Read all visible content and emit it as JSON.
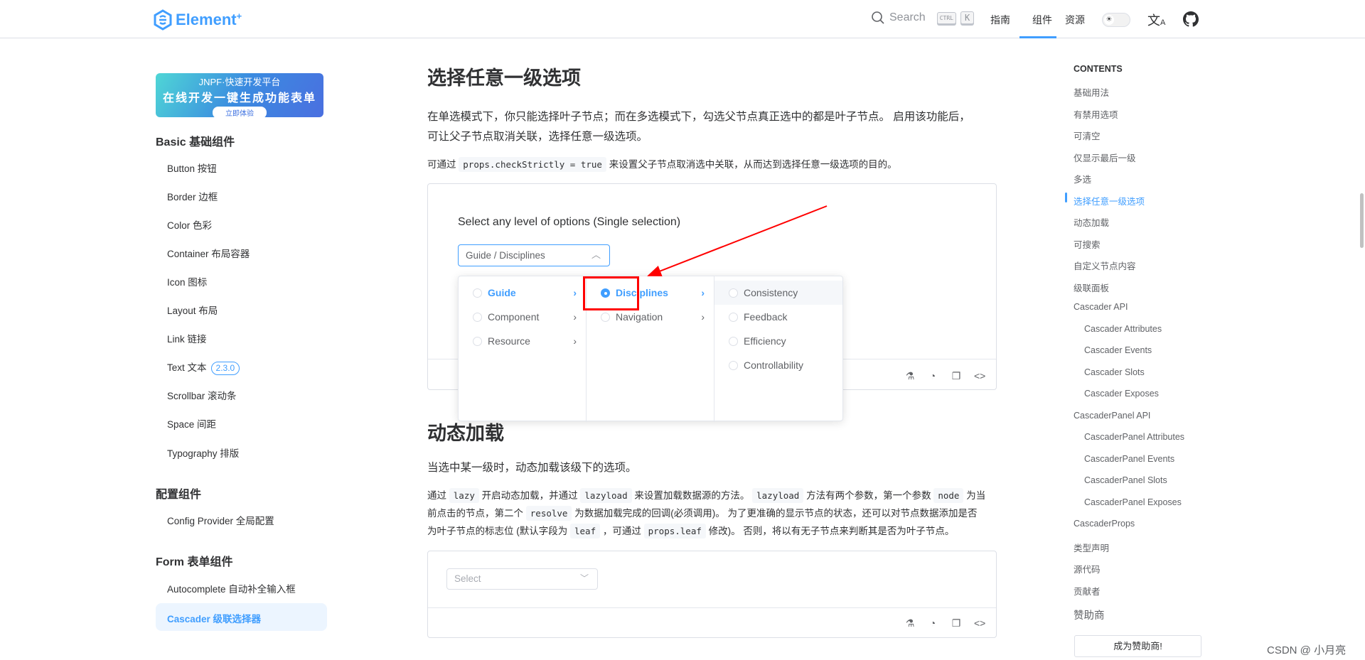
{
  "header": {
    "logo_text": "Element",
    "logo_sup": "+",
    "search": "Search",
    "kbd_ctrl": "CTRL",
    "kbd_k": "K",
    "nav": [
      "指南",
      "组件",
      "资源"
    ],
    "active_nav": "组件"
  },
  "banner": {
    "line1": "JNPF·快速开发平台",
    "line2": "在线开发一键生成功能表单",
    "button": "立即体验"
  },
  "sidebar": {
    "groups": [
      {
        "title": "Basic 基础组件",
        "items": [
          "Button 按钮",
          "Border 边框",
          "Color 色彩",
          "Container 布局容器",
          "Icon 图标",
          "Layout 布局",
          "Link 链接",
          "Text 文本",
          "Scrollbar 滚动条",
          "Space 间距",
          "Typography 排版"
        ]
      },
      {
        "title": "配置组件",
        "items": [
          "Config Provider 全局配置"
        ]
      },
      {
        "title": "Form 表单组件",
        "items": [
          "Autocomplete 自动补全输入框",
          "Cascader 级联选择器"
        ]
      }
    ],
    "text_badge": "2.3.0",
    "active": "Cascader 级联选择器"
  },
  "main": {
    "title1": "选择任意一级选项",
    "para1_line1": "在单选模式下，你只能选择叶子节点；而在多选模式下，勾选父节点真正选中的都是叶子节点。 启用该功能后，",
    "para1_line2": "可让父子节点取消关联，选择任意一级选项。",
    "para2_pre": "可通过 ",
    "para2_code": "props.checkStrictly = true",
    "para2_post": " 来设置父子节点取消选中关联，从而达到选择任意一级选项的目的。",
    "demo1": {
      "label": "Select any level of options (Single selection)",
      "value": "Guide / Disciplines",
      "columns": [
        [
          {
            "label": "Guide",
            "active": true,
            "children": true
          },
          {
            "label": "Component",
            "children": true
          },
          {
            "label": "Resource",
            "children": true
          }
        ],
        [
          {
            "label": "Disciplines",
            "active": true,
            "checked": true,
            "children": true
          },
          {
            "label": "Navigation",
            "children": true
          }
        ],
        [
          {
            "label": "Consistency",
            "hover": true
          },
          {
            "label": "Feedback"
          },
          {
            "label": "Efficiency"
          },
          {
            "label": "Controllability"
          }
        ]
      ]
    },
    "title2": "动态加载",
    "para3": "当选中某一级时，动态加载该级下的选项。",
    "para4": {
      "l1": [
        "通过 ",
        "lazy",
        " 开启动态加载，并通过 ",
        "lazyload",
        " 来设置加载数据源的方法。 ",
        "lazyload",
        " 方法有两个参数，第一个参数 ",
        "node",
        " 为当"
      ],
      "l2": [
        "前点击的节点，第二个 ",
        "resolve",
        " 为数据加载完成的回调(必须调用)。 为了更准确的显示节点的状态，还可以对节点数据添加是否"
      ],
      "l3": [
        "为叶子节点的标志位 (默认字段为 ",
        "leaf",
        " ，可通过 ",
        "props.leaf",
        " 修改)。 否则，将以有无子节点来判断其是否为叶子节点。"
      ]
    },
    "demo2": {
      "placeholder": "Select"
    }
  },
  "toc": {
    "title": "CONTENTS",
    "items": [
      {
        "label": "基础用法"
      },
      {
        "label": "有禁用选项"
      },
      {
        "label": "可清空"
      },
      {
        "label": "仅显示最后一级"
      },
      {
        "label": "多选"
      },
      {
        "label": "选择任意一级选项",
        "active": true
      },
      {
        "label": "动态加载"
      },
      {
        "label": "可搜索"
      },
      {
        "label": "自定义节点内容"
      },
      {
        "label": "级联面板"
      },
      {
        "label": "Cascader API"
      },
      {
        "label": "Cascader Attributes",
        "sub": true
      },
      {
        "label": "Cascader Events",
        "sub": true
      },
      {
        "label": "Cascader Slots",
        "sub": true
      },
      {
        "label": "Cascader Exposes",
        "sub": true
      },
      {
        "label": "CascaderPanel API"
      },
      {
        "label": "CascaderPanel Attributes",
        "sub": true
      },
      {
        "label": "CascaderPanel Events",
        "sub": true
      },
      {
        "label": "CascaderPanel Slots",
        "sub": true
      },
      {
        "label": "CascaderPanel Exposes",
        "sub": true
      },
      {
        "label": "CascaderProps"
      },
      {
        "label": "类型声明"
      },
      {
        "label": "源代码"
      },
      {
        "label": "贡献者"
      }
    ],
    "sponsor_title": "赞助商",
    "sponsor_button": "成为赞助商!"
  },
  "watermark": "CSDN @ 小月亮",
  "colors": {
    "primary": "#409eff",
    "annotation": "#ff0000"
  }
}
